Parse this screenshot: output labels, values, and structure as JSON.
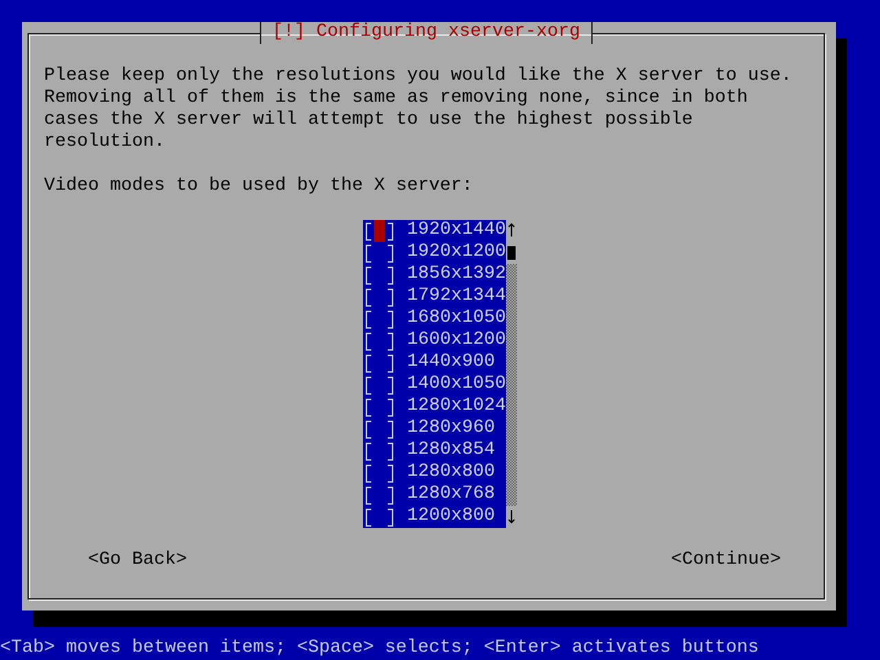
{
  "dialog": {
    "title": "[!] Configuring xserver-xorg",
    "description": "Please keep only the resolutions you would like the X server to use. Removing all of them is the same as removing none, since in both cases the X server will attempt to use the highest possible resolution.",
    "prompt": "Video modes to be used by the X server:",
    "modes": [
      {
        "label": "1920x1440",
        "checked": false,
        "selected": true
      },
      {
        "label": "1920x1200",
        "checked": false,
        "selected": false
      },
      {
        "label": "1856x1392",
        "checked": false,
        "selected": false
      },
      {
        "label": "1792x1344",
        "checked": false,
        "selected": false
      },
      {
        "label": "1680x1050",
        "checked": false,
        "selected": false
      },
      {
        "label": "1600x1200",
        "checked": false,
        "selected": false
      },
      {
        "label": "1440x900",
        "checked": false,
        "selected": false
      },
      {
        "label": "1400x1050",
        "checked": false,
        "selected": false
      },
      {
        "label": "1280x1024",
        "checked": false,
        "selected": false
      },
      {
        "label": "1280x960",
        "checked": false,
        "selected": false
      },
      {
        "label": "1280x854",
        "checked": false,
        "selected": false
      },
      {
        "label": "1280x800",
        "checked": false,
        "selected": false
      },
      {
        "label": "1280x768",
        "checked": false,
        "selected": false
      },
      {
        "label": "1200x800",
        "checked": false,
        "selected": false
      }
    ],
    "buttons": [
      {
        "label": "<Go Back>",
        "kind": "back"
      },
      {
        "label": "<Continue>",
        "kind": "continue"
      }
    ]
  },
  "status_bar": "<Tab> moves between items; <Space> selects; <Enter> activates buttons"
}
